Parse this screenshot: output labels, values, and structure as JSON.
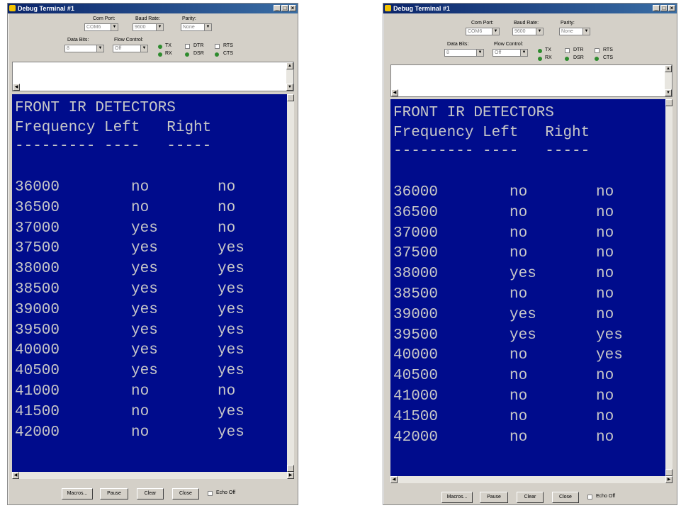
{
  "windows": [
    {
      "title": "Debug Terminal #1",
      "com_port_label": "Com Port:",
      "com_port_value": "COM6",
      "baud_rate_label": "Baud Rate:",
      "baud_rate_value": "9600",
      "parity_label": "Parity:",
      "parity_value": "None",
      "data_bits_label": "Data Bits:",
      "data_bits_value": "8",
      "flow_control_label": "Flow Control:",
      "flow_control_value": "Off",
      "tx_label": "TX",
      "rx_label": "RX",
      "dtr_label": "DTR",
      "dsr_label": "DSR",
      "rts_label": "RTS",
      "cts_label": "CTS",
      "header_line1": "FRONT IR DETECTORS",
      "header_line2": "Frequency Left   Right",
      "header_line3": "--------- ----   -----",
      "rows": [
        {
          "freq": "36000",
          "left": "no",
          "right": "no"
        },
        {
          "freq": "36500",
          "left": "no",
          "right": "no"
        },
        {
          "freq": "37000",
          "left": "yes",
          "right": "no"
        },
        {
          "freq": "37500",
          "left": "yes",
          "right": "yes"
        },
        {
          "freq": "38000",
          "left": "yes",
          "right": "yes"
        },
        {
          "freq": "38500",
          "left": "yes",
          "right": "yes"
        },
        {
          "freq": "39000",
          "left": "yes",
          "right": "yes"
        },
        {
          "freq": "39500",
          "left": "yes",
          "right": "yes"
        },
        {
          "freq": "40000",
          "left": "yes",
          "right": "yes"
        },
        {
          "freq": "40500",
          "left": "yes",
          "right": "yes"
        },
        {
          "freq": "41000",
          "left": "no",
          "right": "no"
        },
        {
          "freq": "41500",
          "left": "no",
          "right": "yes"
        },
        {
          "freq": "42000",
          "left": "no",
          "right": "yes"
        }
      ],
      "buttons": {
        "macros": "Macros...",
        "pause": "Pause",
        "clear": "Clear",
        "close": "Close",
        "echo_off": "Echo Off"
      }
    },
    {
      "title": "Debug Terminal #1",
      "com_port_label": "Com Port:",
      "com_port_value": "COM6",
      "baud_rate_label": "Baud Rate:",
      "baud_rate_value": "9600",
      "parity_label": "Parity:",
      "parity_value": "None",
      "data_bits_label": "Data Bits:",
      "data_bits_value": "8",
      "flow_control_label": "Flow Control:",
      "flow_control_value": "Off",
      "tx_label": "TX",
      "rx_label": "RX",
      "dtr_label": "DTR",
      "dsr_label": "DSR",
      "rts_label": "RTS",
      "cts_label": "CTS",
      "header_line1": "FRONT IR DETECTORS",
      "header_line2": "Frequency Left   Right",
      "header_line3": "--------- ----   -----",
      "rows": [
        {
          "freq": "36000",
          "left": "no",
          "right": "no"
        },
        {
          "freq": "36500",
          "left": "no",
          "right": "no"
        },
        {
          "freq": "37000",
          "left": "no",
          "right": "no"
        },
        {
          "freq": "37500",
          "left": "no",
          "right": "no"
        },
        {
          "freq": "38000",
          "left": "yes",
          "right": "no"
        },
        {
          "freq": "38500",
          "left": "no",
          "right": "no"
        },
        {
          "freq": "39000",
          "left": "yes",
          "right": "no"
        },
        {
          "freq": "39500",
          "left": "yes",
          "right": "yes"
        },
        {
          "freq": "40000",
          "left": "no",
          "right": "yes"
        },
        {
          "freq": "40500",
          "left": "no",
          "right": "no"
        },
        {
          "freq": "41000",
          "left": "no",
          "right": "no"
        },
        {
          "freq": "41500",
          "left": "no",
          "right": "no"
        },
        {
          "freq": "42000",
          "left": "no",
          "right": "no"
        }
      ],
      "buttons": {
        "macros": "Macros...",
        "pause": "Pause",
        "clear": "Clear",
        "close": "Close",
        "echo_off": "Echo Off"
      }
    }
  ]
}
